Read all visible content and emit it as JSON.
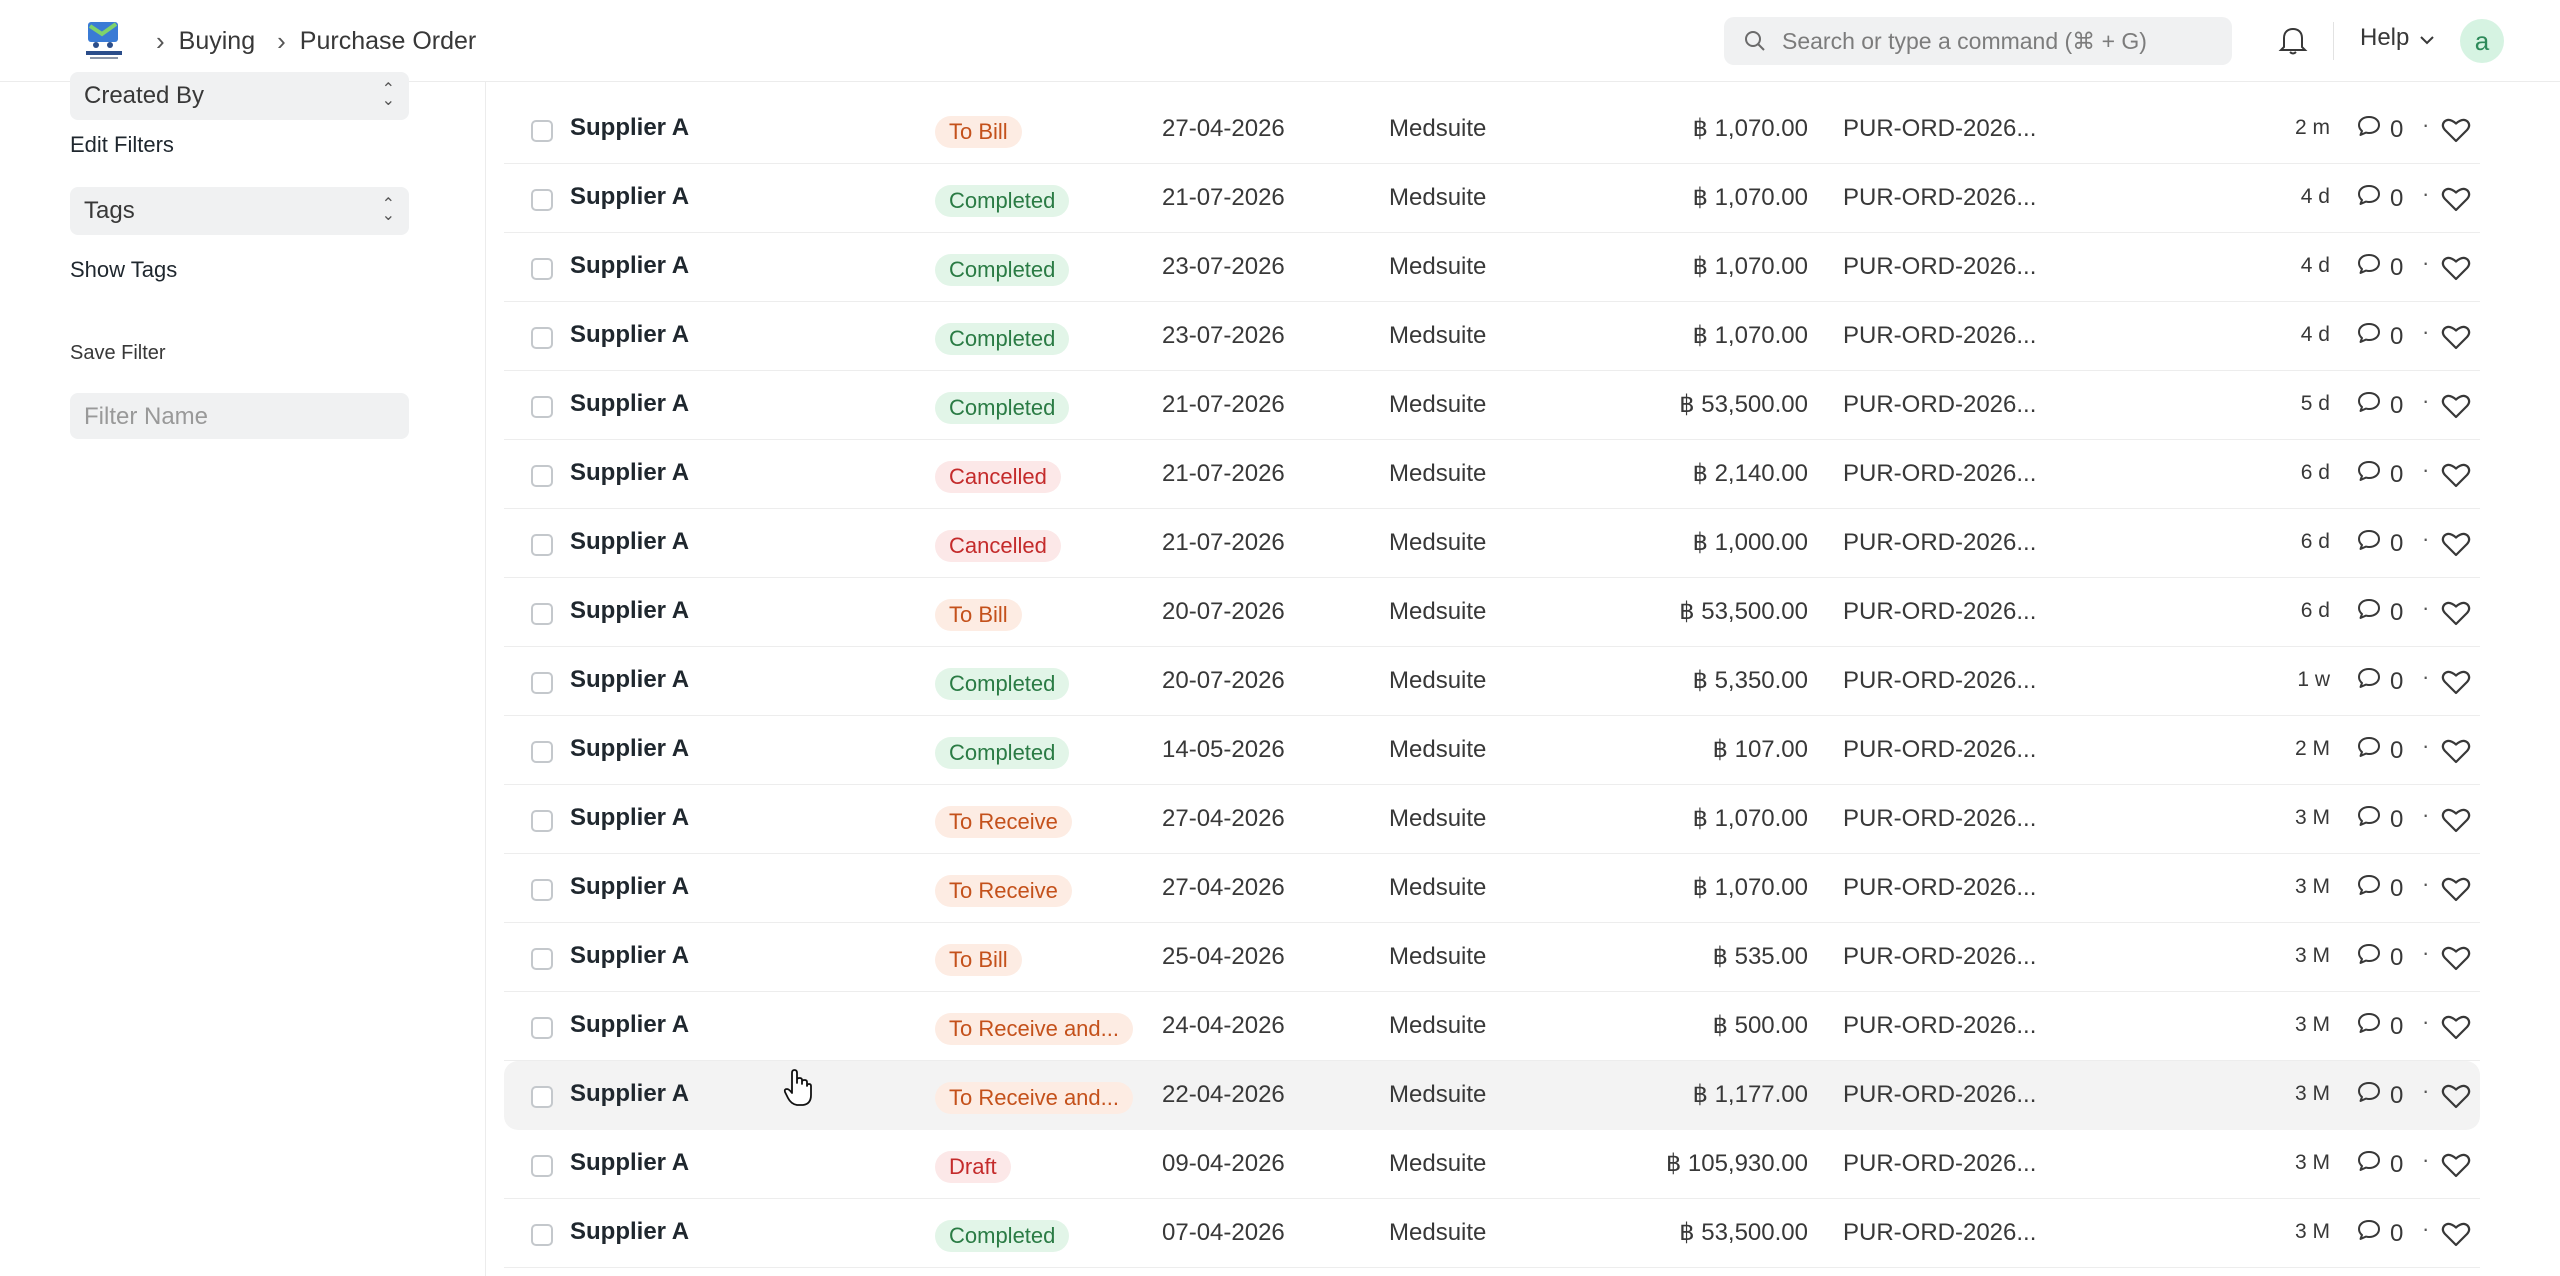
{
  "navbar": {
    "breadcrumbs": [
      "Buying",
      "Purchase Order"
    ],
    "search_placeholder": "Search or type a command (⌘ + G)",
    "help_label": "Help",
    "avatar_initial": "a"
  },
  "sidebar": {
    "created_by_label": "Created By",
    "edit_filters_label": "Edit Filters",
    "tags_label": "Tags",
    "show_tags_label": "Show Tags",
    "save_filter_label": "Save Filter",
    "filter_name_placeholder": "Filter Name"
  },
  "rows": [
    {
      "supplier": "Supplier A",
      "status": "To Bill",
      "status_color": "orange",
      "date": "27-04-2026",
      "company": "Medsuite",
      "amount": "฿ 1,070.00",
      "po": "PUR-ORD-2026...",
      "age": "2 m",
      "comments": "0"
    },
    {
      "supplier": "Supplier A",
      "status": "Completed",
      "status_color": "green",
      "date": "21-07-2026",
      "company": "Medsuite",
      "amount": "฿ 1,070.00",
      "po": "PUR-ORD-2026...",
      "age": "4 d",
      "comments": "0"
    },
    {
      "supplier": "Supplier A",
      "status": "Completed",
      "status_color": "green",
      "date": "23-07-2026",
      "company": "Medsuite",
      "amount": "฿ 1,070.00",
      "po": "PUR-ORD-2026...",
      "age": "4 d",
      "comments": "0"
    },
    {
      "supplier": "Supplier A",
      "status": "Completed",
      "status_color": "green",
      "date": "23-07-2026",
      "company": "Medsuite",
      "amount": "฿ 1,070.00",
      "po": "PUR-ORD-2026...",
      "age": "4 d",
      "comments": "0"
    },
    {
      "supplier": "Supplier A",
      "status": "Completed",
      "status_color": "green",
      "date": "21-07-2026",
      "company": "Medsuite",
      "amount": "฿ 53,500.00",
      "po": "PUR-ORD-2026...",
      "age": "5 d",
      "comments": "0"
    },
    {
      "supplier": "Supplier A",
      "status": "Cancelled",
      "status_color": "red",
      "date": "21-07-2026",
      "company": "Medsuite",
      "amount": "฿ 2,140.00",
      "po": "PUR-ORD-2026...",
      "age": "6 d",
      "comments": "0"
    },
    {
      "supplier": "Supplier A",
      "status": "Cancelled",
      "status_color": "red",
      "date": "21-07-2026",
      "company": "Medsuite",
      "amount": "฿ 1,000.00",
      "po": "PUR-ORD-2026...",
      "age": "6 d",
      "comments": "0"
    },
    {
      "supplier": "Supplier A",
      "status": "To Bill",
      "status_color": "orange",
      "date": "20-07-2026",
      "company": "Medsuite",
      "amount": "฿ 53,500.00",
      "po": "PUR-ORD-2026...",
      "age": "6 d",
      "comments": "0"
    },
    {
      "supplier": "Supplier A",
      "status": "Completed",
      "status_color": "green",
      "date": "20-07-2026",
      "company": "Medsuite",
      "amount": "฿ 5,350.00",
      "po": "PUR-ORD-2026...",
      "age": "1 w",
      "comments": "0"
    },
    {
      "supplier": "Supplier A",
      "status": "Completed",
      "status_color": "green",
      "date": "14-05-2026",
      "company": "Medsuite",
      "amount": "฿ 107.00",
      "po": "PUR-ORD-2026...",
      "age": "2 M",
      "comments": "0"
    },
    {
      "supplier": "Supplier A",
      "status": "To Receive",
      "status_color": "orange",
      "date": "27-04-2026",
      "company": "Medsuite",
      "amount": "฿ 1,070.00",
      "po": "PUR-ORD-2026...",
      "age": "3 M",
      "comments": "0"
    },
    {
      "supplier": "Supplier A",
      "status": "To Receive",
      "status_color": "orange",
      "date": "27-04-2026",
      "company": "Medsuite",
      "amount": "฿ 1,070.00",
      "po": "PUR-ORD-2026...",
      "age": "3 M",
      "comments": "0"
    },
    {
      "supplier": "Supplier A",
      "status": "To Bill",
      "status_color": "orange",
      "date": "25-04-2026",
      "company": "Medsuite",
      "amount": "฿ 535.00",
      "po": "PUR-ORD-2026...",
      "age": "3 M",
      "comments": "0"
    },
    {
      "supplier": "Supplier A",
      "status": "To Receive and...",
      "status_color": "orange",
      "date": "24-04-2026",
      "company": "Medsuite",
      "amount": "฿ 500.00",
      "po": "PUR-ORD-2026...",
      "age": "3 M",
      "comments": "0"
    },
    {
      "supplier": "Supplier A",
      "status": "To Receive and...",
      "status_color": "orange",
      "date": "22-04-2026",
      "company": "Medsuite",
      "amount": "฿ 1,177.00",
      "po": "PUR-ORD-2026...",
      "age": "3 M",
      "comments": "0"
    },
    {
      "supplier": "Supplier A",
      "status": "Draft",
      "status_color": "red",
      "date": "09-04-2026",
      "company": "Medsuite",
      "amount": "฿ 105,930.00",
      "po": "PUR-ORD-2026...",
      "age": "3 M",
      "comments": "0"
    },
    {
      "supplier": "Supplier A",
      "status": "Completed",
      "status_color": "green",
      "date": "07-04-2026",
      "company": "Medsuite",
      "amount": "฿ 53,500.00",
      "po": "PUR-ORD-2026...",
      "age": "3 M",
      "comments": "0"
    }
  ]
}
